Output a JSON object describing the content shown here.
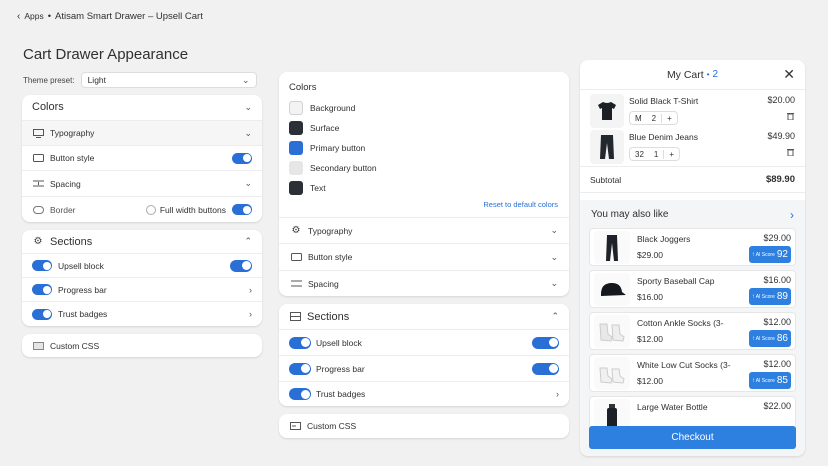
{
  "header": {
    "back_label": "Apps",
    "separator": "•",
    "app_title": "Atisam Smart Drawer – Upsell Cart"
  },
  "page_title": "Cart Drawer Appearance",
  "left": {
    "theme_preset_label": "Theme preset:",
    "theme_preset_value": "Light",
    "colors_label": "Colors",
    "typography_label": "Typography",
    "button_style_label": "Button style",
    "spacing_label": "Spacing",
    "border_label": "Border",
    "full_width_label": "Full width buttons",
    "sections_label": "Sections",
    "upsell_label": "Upsell block",
    "progress_label": "Progress bar",
    "trust_label": "Trust badges",
    "custom_css_label": "Custom CSS"
  },
  "middle": {
    "colors_title": "Colors",
    "color_items": [
      {
        "label": "Background",
        "color": "#f3f3f3"
      },
      {
        "label": "Surface",
        "color": "#2b2f36"
      },
      {
        "label": "Primary button",
        "color": "#2a6fd6"
      },
      {
        "label": "Secondary button",
        "color": "#e6e6e6"
      },
      {
        "label": "Text",
        "color": "#2b2f36"
      }
    ],
    "reset_label": "Reset to default colors",
    "typography_label": "Typography",
    "button_style_label": "Button style",
    "spacing_label": "Spacing",
    "sections_label": "Sections",
    "upsell_label": "Upsell block",
    "progress_label": "Progress bar",
    "trust_label": "Trust badges",
    "custom_css_label": "Custom CSS"
  },
  "cart": {
    "title": "My Cart",
    "dot": "•",
    "count": "2",
    "items": [
      {
        "name": "Solid Black T-Shirt",
        "price": "$20.00",
        "size": "M",
        "qty": "2",
        "plus": "+"
      },
      {
        "name": "Blue Denim Jeans",
        "price": "$49.90",
        "size": "32",
        "qty": "1",
        "plus": "+"
      }
    ],
    "subtotal_label": "Subtotal",
    "subtotal_value": "$89.90",
    "upsell_title": "You may also like",
    "upsell_items": [
      {
        "name": "Black Joggers",
        "price": "$29.00",
        "sub_price": "$29.00",
        "ai_label": "AI Score",
        "score": "92"
      },
      {
        "name": "Sporty Baseball Cap",
        "price": "$16.00",
        "sub_price": "$16.00",
        "ai_label": "AI Score",
        "score": "89"
      },
      {
        "name": "Cotton Ankle Socks (3-",
        "price": "$12.00",
        "sub_price": "$12.00",
        "ai_label": "AI Score",
        "score": "86"
      },
      {
        "name": "White Low Cut Socks (3-",
        "price": "$12.00",
        "sub_price": "$12.00",
        "ai_label": "AI Score",
        "score": "85"
      },
      {
        "name": "Large Water Bottle",
        "price": "$22.00",
        "sub_price": "",
        "ai_label": "",
        "score": ""
      }
    ],
    "checkout_label": "Checkout"
  }
}
